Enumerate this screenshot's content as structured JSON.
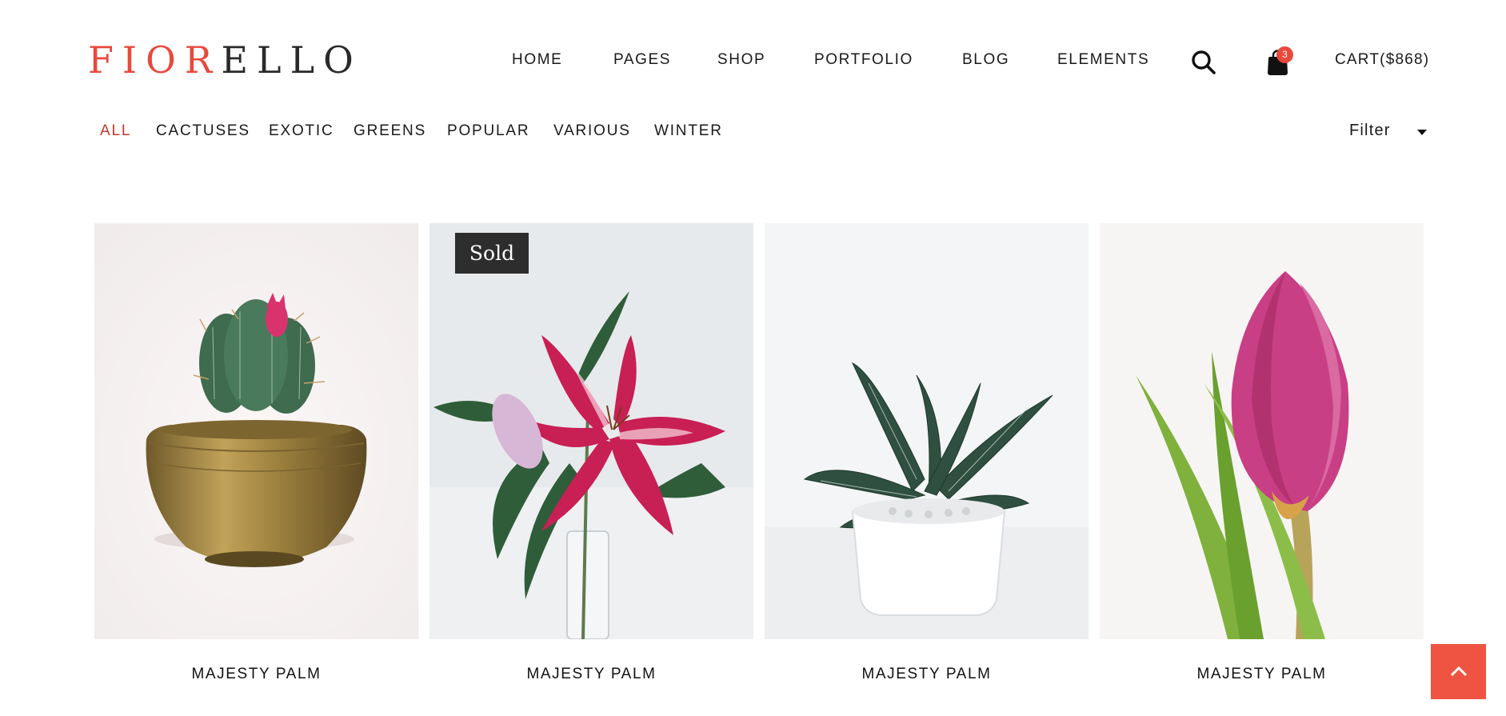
{
  "brand": {
    "accent": "FIOR",
    "rest": "ELLO",
    "accent_color": "#e8493c"
  },
  "nav": {
    "items": [
      {
        "label": "HOME"
      },
      {
        "label": "PAGES"
      },
      {
        "label": "SHOP"
      },
      {
        "label": "PORTFOLIO"
      },
      {
        "label": "BLOG"
      },
      {
        "label": "ELEMENTS"
      }
    ],
    "search_icon": "search-icon",
    "cart_icon": "shopping-bag-icon",
    "cart_count": "3",
    "cart_label": "CART($868)"
  },
  "categories": {
    "items": [
      {
        "label": "ALL",
        "active": true
      },
      {
        "label": "CACTUSES"
      },
      {
        "label": "EXOTIC"
      },
      {
        "label": "GREENS"
      },
      {
        "label": "POPULAR"
      },
      {
        "label": "VARIOUS"
      },
      {
        "label": "WINTER"
      }
    ],
    "filter_label": "Filter",
    "filter_icon": "caret-down-icon"
  },
  "products": [
    {
      "title": "MAJESTY PALM",
      "image": "cactus in brass bowl"
    },
    {
      "title": "MAJESTY PALM",
      "image": "pink stargazer lily",
      "badge": "Sold"
    },
    {
      "title": "MAJESTY PALM",
      "image": "succulent in white pot"
    },
    {
      "title": "MAJESTY PALM",
      "image": "pink tulip"
    }
  ],
  "back_to_top_icon": "chevron-up-icon",
  "colors": {
    "accent": "#e8493c",
    "badge_bg": "#2d2d2d",
    "back_to_top": "#ef5443"
  }
}
